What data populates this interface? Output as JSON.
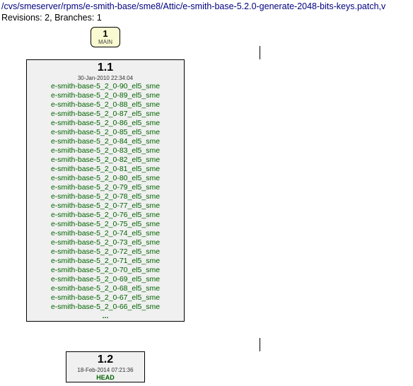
{
  "header": {
    "path": "/cvs/smeserver/rpms/e-smith-base/sme8/Attic/e-smith-base-5.2.0-generate-2048-bits-keys.patch,v",
    "revisions_label": "Revisions:",
    "revisions_value": "2,",
    "branches_label": "Branches:",
    "branches_value": "1"
  },
  "branch": {
    "number": "1",
    "name": "MAIN"
  },
  "rev11": {
    "number": "1.1",
    "date": "30-Jan-2010 22:34:04",
    "tags": [
      "e-smith-base-5_2_0-90_el5_sme",
      "e-smith-base-5_2_0-89_el5_sme",
      "e-smith-base-5_2_0-88_el5_sme",
      "e-smith-base-5_2_0-87_el5_sme",
      "e-smith-base-5_2_0-86_el5_sme",
      "e-smith-base-5_2_0-85_el5_sme",
      "e-smith-base-5_2_0-84_el5_sme",
      "e-smith-base-5_2_0-83_el5_sme",
      "e-smith-base-5_2_0-82_el5_sme",
      "e-smith-base-5_2_0-81_el5_sme",
      "e-smith-base-5_2_0-80_el5_sme",
      "e-smith-base-5_2_0-79_el5_sme",
      "e-smith-base-5_2_0-78_el5_sme",
      "e-smith-base-5_2_0-77_el5_sme",
      "e-smith-base-5_2_0-76_el5_sme",
      "e-smith-base-5_2_0-75_el5_sme",
      "e-smith-base-5_2_0-74_el5_sme",
      "e-smith-base-5_2_0-73_el5_sme",
      "e-smith-base-5_2_0-72_el5_sme",
      "e-smith-base-5_2_0-71_el5_sme",
      "e-smith-base-5_2_0-70_el5_sme",
      "e-smith-base-5_2_0-69_el5_sme",
      "e-smith-base-5_2_0-68_el5_sme",
      "e-smith-base-5_2_0-67_el5_sme",
      "e-smith-base-5_2_0-66_el5_sme"
    ],
    "more": "..."
  },
  "rev12": {
    "number": "1.2",
    "date": "18-Feb-2014 07:21:36",
    "head": "HEAD"
  }
}
